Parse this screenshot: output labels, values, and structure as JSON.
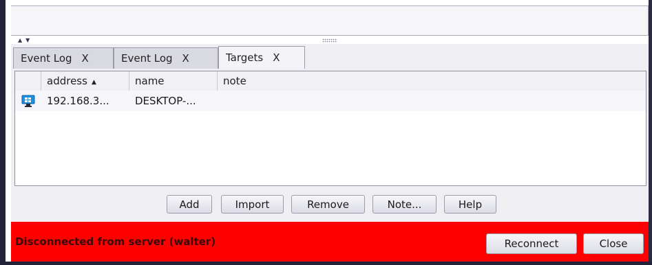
{
  "tabs": [
    {
      "label": "Event Log",
      "close": "X"
    },
    {
      "label": "Event Log",
      "close": "X"
    },
    {
      "label": "Targets",
      "close": "X",
      "active": true
    }
  ],
  "table": {
    "columns": [
      "address",
      "name",
      "note"
    ],
    "sort_column": "address",
    "sort_direction": "ascending",
    "sort_glyph": "▲",
    "rows": [
      {
        "icon": "windows-monitor-icon",
        "address": "192.168.3...",
        "name": "DESKTOP-...",
        "note": ""
      }
    ]
  },
  "buttons": {
    "add": "Add",
    "import": "Import",
    "remove": "Remove",
    "note": "Note...",
    "help": "Help"
  },
  "status": {
    "message": "Disconnected from server (walter)",
    "reconnect": "Reconnect",
    "close": "Close",
    "background_color": "#ff0000"
  },
  "split_arrows": "▲▼"
}
